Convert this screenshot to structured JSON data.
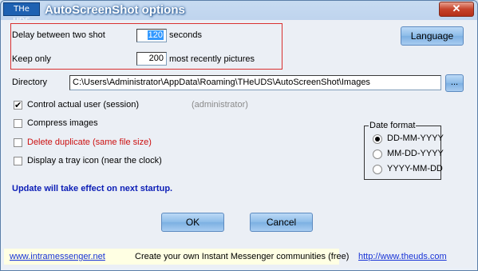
{
  "window": {
    "title": "AutoScreenShot options",
    "logo_text": "THe UDS",
    "close_symbol": "✕"
  },
  "settings": {
    "delay_label": "Delay between two shot",
    "delay_value": "120",
    "delay_unit": "seconds",
    "keep_label": "Keep only",
    "keep_value": "200",
    "keep_unit": "most recently pictures",
    "directory_label": "Directory",
    "directory_value": "C:\\Users\\Administrator\\AppData\\Roaming\\THeUDS\\AutoScreenShot\\Images",
    "browse_label": "..."
  },
  "buttons": {
    "language": "Language",
    "ok": "OK",
    "cancel": "Cancel"
  },
  "options": {
    "control_user": {
      "label": "Control actual user (session)",
      "checked": true,
      "mark": "✔"
    },
    "admin_note": "(administrator)",
    "compress": {
      "label": "Compress images",
      "checked": false
    },
    "delete_duplicate": {
      "label": "Delete duplicate (same file size)",
      "checked": false
    },
    "tray_icon": {
      "label": "Display a tray icon (near the clock)",
      "checked": false
    }
  },
  "date_format": {
    "title": "Date format",
    "options": [
      "DD-MM-YYYY",
      "MM-DD-YYYY",
      "YYYY-MM-DD"
    ],
    "selected": "DD-MM-YYYY"
  },
  "notice": "Update will take effect on next startup.",
  "footer": {
    "link_left": "www.intramessenger.net",
    "ad_text": "Create your own Instant Messenger communities (free)",
    "link_right": "http://www.theuds.com"
  },
  "colors": {
    "accent": "#1e61b2",
    "highlight_border": "#d93030",
    "warning_text": "#cc1010",
    "notice_text": "#0b1db6",
    "link": "#1833d6"
  }
}
